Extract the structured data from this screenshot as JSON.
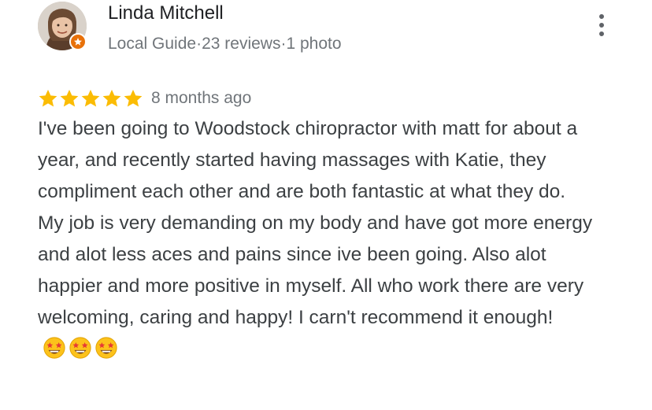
{
  "reviewer": {
    "name": "Linda Mitchell",
    "badge": "Local Guide",
    "separator": "·",
    "reviews": "23 reviews",
    "photos": "1 photo"
  },
  "rating": {
    "stars": 5,
    "age": "8 months ago"
  },
  "review": {
    "paragraph1": "I've been going to Woodstock chiropractor with matt for about a year, and recently started having massages with Katie, they compliment each other and are both fantastic at what they do.",
    "paragraph2": "My job is very demanding on my body and have got more energy and alot less aces and pains since ive been going. Also alot happier and more positive in myself. All who work there are very welcoming, caring and happy! I carn't recommend it enough!"
  },
  "icons": {
    "avatar": "user-photo",
    "badge": "local-guide-star-icon",
    "more": "more-vert-icon",
    "star": "star-icon",
    "emoji": "star-struck-emoji"
  },
  "colors": {
    "star": "#fbbc04",
    "badge": "#e8710a",
    "meta_text": "#70757a",
    "body_text": "#3c4043"
  }
}
